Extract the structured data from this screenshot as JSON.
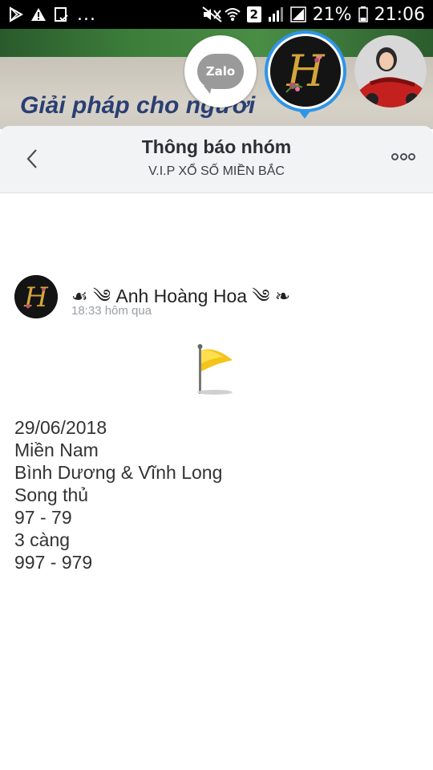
{
  "status_bar": {
    "notifications": [
      "play-store-icon",
      "warning-icon",
      "clipboard-check-icon"
    ],
    "more": "...",
    "sim_badge": "2",
    "battery_percent": "21%",
    "time": "21:06"
  },
  "banner": {
    "slogan": "Giải pháp cho người"
  },
  "avatars": {
    "zalo_label": "Zalo",
    "selected_initial": "H"
  },
  "header": {
    "title": "Thông báo nhóm",
    "subtitle": "V.I.P XỔ SỐ MIỀN BẮC"
  },
  "post": {
    "author": "☙ ༄ Anh Hoàng Hoa ༄ ❧",
    "time": "18:33 hôm qua",
    "lines": [
      "29/06/2018",
      "Miền Nam",
      "Bình Dương & Vĩnh Long",
      "Song thủ",
      "97 - 79",
      "3 càng",
      "997 - 979"
    ]
  },
  "colors": {
    "accent": "#2e95e8",
    "header_bg": "#f2f3f5",
    "text": "#333333",
    "muted": "#9aa0a6"
  }
}
